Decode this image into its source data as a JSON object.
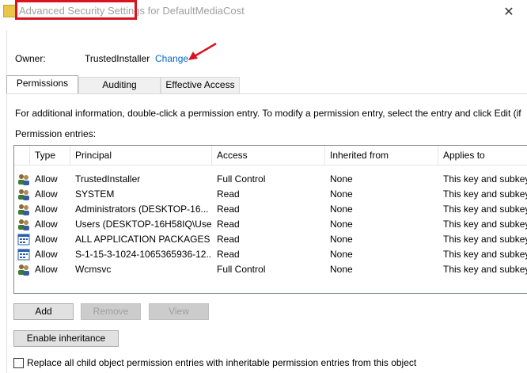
{
  "window": {
    "title_highlighted": "Advanced Security Settings",
    "title_rest": " for DefaultMediaCost",
    "close_glyph": "✕"
  },
  "owner": {
    "label": "Owner:",
    "value": "TrustedInstaller",
    "change_link": "Change"
  },
  "tabs": [
    {
      "label": "Permissions",
      "active": true
    },
    {
      "label": "Auditing",
      "active": false
    },
    {
      "label": "Effective Access",
      "active": false
    }
  ],
  "info_text": "For additional information, double-click a permission entry. To modify a permission entry, select the entry and click Edit (if",
  "entries_label": "Permission entries:",
  "columns": [
    "Type",
    "Principal",
    "Access",
    "Inherited from",
    "Applies to"
  ],
  "entries": [
    {
      "icon": "user-group-icon",
      "type": "Allow",
      "principal": "TrustedInstaller",
      "access": "Full Control",
      "inherited": "None",
      "applies": "This key and subkeys"
    },
    {
      "icon": "user-group-icon",
      "type": "Allow",
      "principal": "SYSTEM",
      "access": "Read",
      "inherited": "None",
      "applies": "This key and subkeys"
    },
    {
      "icon": "user-group-icon",
      "type": "Allow",
      "principal": "Administrators (DESKTOP-16...",
      "access": "Read",
      "inherited": "None",
      "applies": "This key and subkeys"
    },
    {
      "icon": "user-group-icon",
      "type": "Allow",
      "principal": "Users (DESKTOP-16H58IQ\\Use...",
      "access": "Read",
      "inherited": "None",
      "applies": "This key and subkeys"
    },
    {
      "icon": "app-package-icon",
      "type": "Allow",
      "principal": "ALL APPLICATION PACKAGES",
      "access": "Read",
      "inherited": "None",
      "applies": "This key and subkeys"
    },
    {
      "icon": "app-package-icon",
      "type": "Allow",
      "principal": "S-1-15-3-1024-1065365936-12...",
      "access": "Read",
      "inherited": "None",
      "applies": "This key and subkeys"
    },
    {
      "icon": "user-group-icon",
      "type": "Allow",
      "principal": "Wcmsvc",
      "access": "Full Control",
      "inherited": "None",
      "applies": "This key and subkeys"
    }
  ],
  "buttons": {
    "add": "Add",
    "remove": "Remove",
    "view": "View",
    "enable_inheritance": "Enable inheritance"
  },
  "replace_checkbox": {
    "label": "Replace all child object permission entries with inheritable permission entries from this object",
    "checked": false
  },
  "colors": {
    "highlight": "#d9141e",
    "link": "#0066cc"
  }
}
